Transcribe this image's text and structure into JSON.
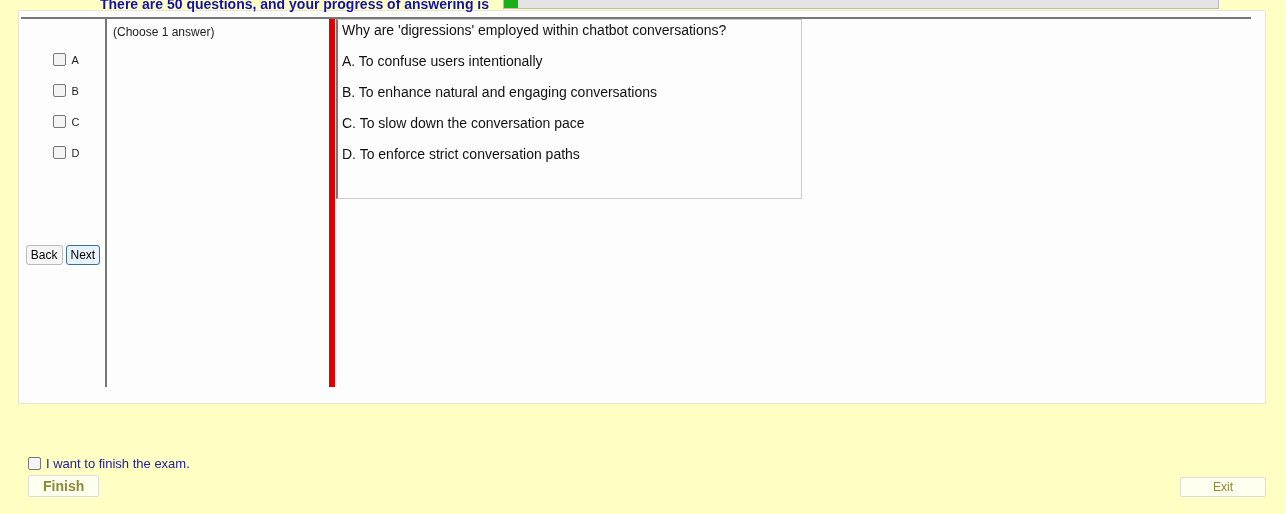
{
  "header": {
    "progress_text": "There are 50 questions, and your progress of answering is",
    "progress": {
      "level": 0.02
    }
  },
  "answer_panel": {
    "options": [
      {
        "label": "A",
        "checked": false
      },
      {
        "label": "B",
        "checked": false
      },
      {
        "label": "C",
        "checked": false
      },
      {
        "label": "D",
        "checked": false
      }
    ],
    "buttons": [
      {
        "label": "Back",
        "focused": false
      },
      {
        "label": "Next",
        "focused": true
      }
    ],
    "instruction": "(Choose 1 answer)"
  },
  "question": {
    "text": "Why are 'digressions' employed within chatbot conversations?",
    "choices": [
      "A.  To confuse users intentionally",
      "B.  To enhance natural and engaging conversations",
      "C.  To slow down the conversation pace",
      "D.  To enforce strict conversation paths"
    ]
  },
  "footer": {
    "finish_check": {
      "label": "I want to finish the exam.",
      "checked": false
    },
    "finish_button": {
      "label": "Finish",
      "disabled": true
    },
    "exit_button": {
      "label": "Exit",
      "disabled": true
    }
  }
}
